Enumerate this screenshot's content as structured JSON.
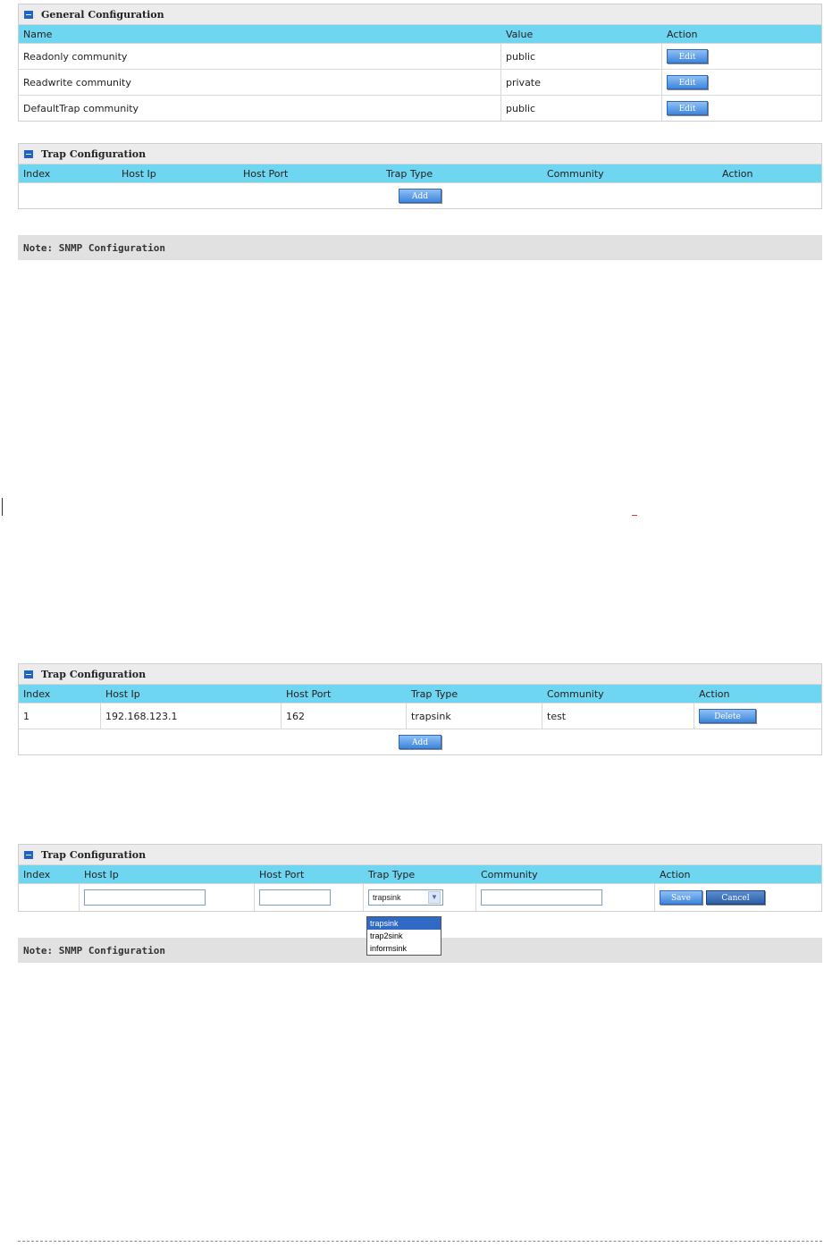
{
  "general": {
    "title": "General Configuration",
    "headers": [
      "Name",
      "Value",
      "Action"
    ],
    "rows": [
      {
        "name": "Readonly community",
        "value": "public",
        "action": "Edit"
      },
      {
        "name": "Readwrite community",
        "value": "private",
        "action": "Edit"
      },
      {
        "name": "DefaultTrap community",
        "value": "public",
        "action": "Edit"
      }
    ]
  },
  "trap1": {
    "title": "Trap Configuration",
    "headers": [
      "Index",
      "Host Ip",
      "Host Port",
      "Trap Type",
      "Community",
      "Action"
    ],
    "add_label": "Add"
  },
  "note1": "Note: SNMP Configuration",
  "trap2": {
    "title": "Trap Configuration",
    "headers": [
      "Index",
      "Host Ip",
      "Host Port",
      "Trap Type",
      "Community",
      "Action"
    ],
    "row": {
      "index": "1",
      "host_ip": "192.168.123.1",
      "host_port": "162",
      "trap_type": "trapsink",
      "community": "test",
      "action": "Delete"
    },
    "add_label": "Add"
  },
  "trap3": {
    "title": "Trap Configuration",
    "headers": [
      "Index",
      "Host Ip",
      "Host Port",
      "Trap Type",
      "Community",
      "Action"
    ],
    "select_value": "trapsink",
    "options": [
      "trapsink",
      "trap2sink",
      "informsink"
    ],
    "save_label": "Save",
    "cancel_label": "Cancel"
  },
  "note2": "Note: SNMP Configuration"
}
